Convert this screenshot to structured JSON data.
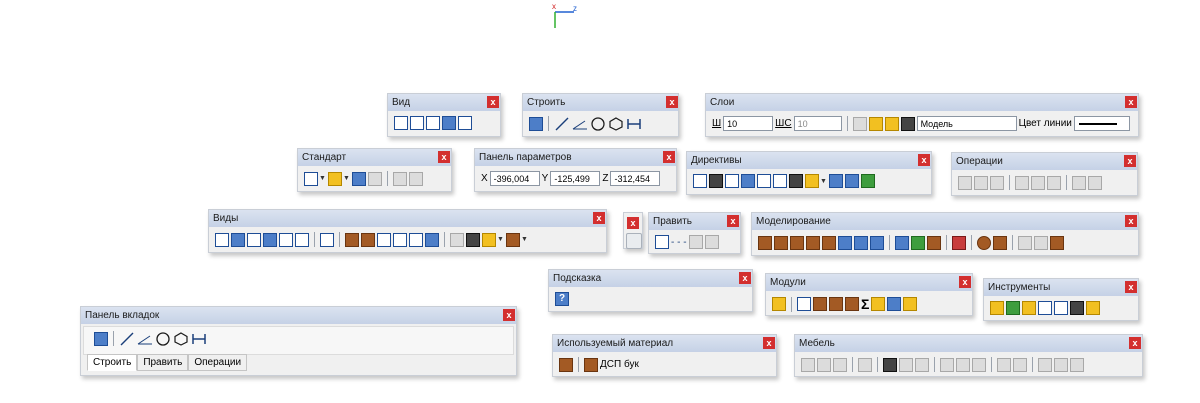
{
  "axis": {
    "x_label": "x",
    "z_label": "z"
  },
  "close_glyph": "x",
  "panels": {
    "vid": {
      "title": "Вид"
    },
    "stroit": {
      "title": "Строить"
    },
    "sloi": {
      "title": "Слои",
      "w_label": "Ш",
      "w_value": "10",
      "ws_label": "ШС",
      "ws_value": "10",
      "layer_name": "Модель",
      "line_color_label": "Цвет линии",
      "layer_color": "#000000"
    },
    "standart": {
      "title": "Стандарт"
    },
    "params": {
      "title": "Панель параметров",
      "x_label": "X",
      "x_value": "-396,004",
      "y_label": "Y",
      "y_value": "-125,499",
      "z_label": "Z",
      "z_value": "-312,454"
    },
    "direktivy": {
      "title": "Директивы"
    },
    "operacii": {
      "title": "Операции"
    },
    "vidy": {
      "title": "Виды"
    },
    "pravit": {
      "title": "Править",
      "dashes": "- - -"
    },
    "modelirovanie": {
      "title": "Моделирование"
    },
    "podskazka": {
      "title": "Подсказка",
      "help_glyph": "?"
    },
    "moduli": {
      "title": "Модули",
      "sigma": "Σ"
    },
    "instrumenty": {
      "title": "Инструменты"
    },
    "vkladki": {
      "title": "Панель вкладок",
      "tabs": [
        "Строить",
        "Править",
        "Операции"
      ]
    },
    "material": {
      "title": "Используемый материал",
      "value": "ДСП бук"
    },
    "mebel": {
      "title": "Мебель"
    }
  }
}
